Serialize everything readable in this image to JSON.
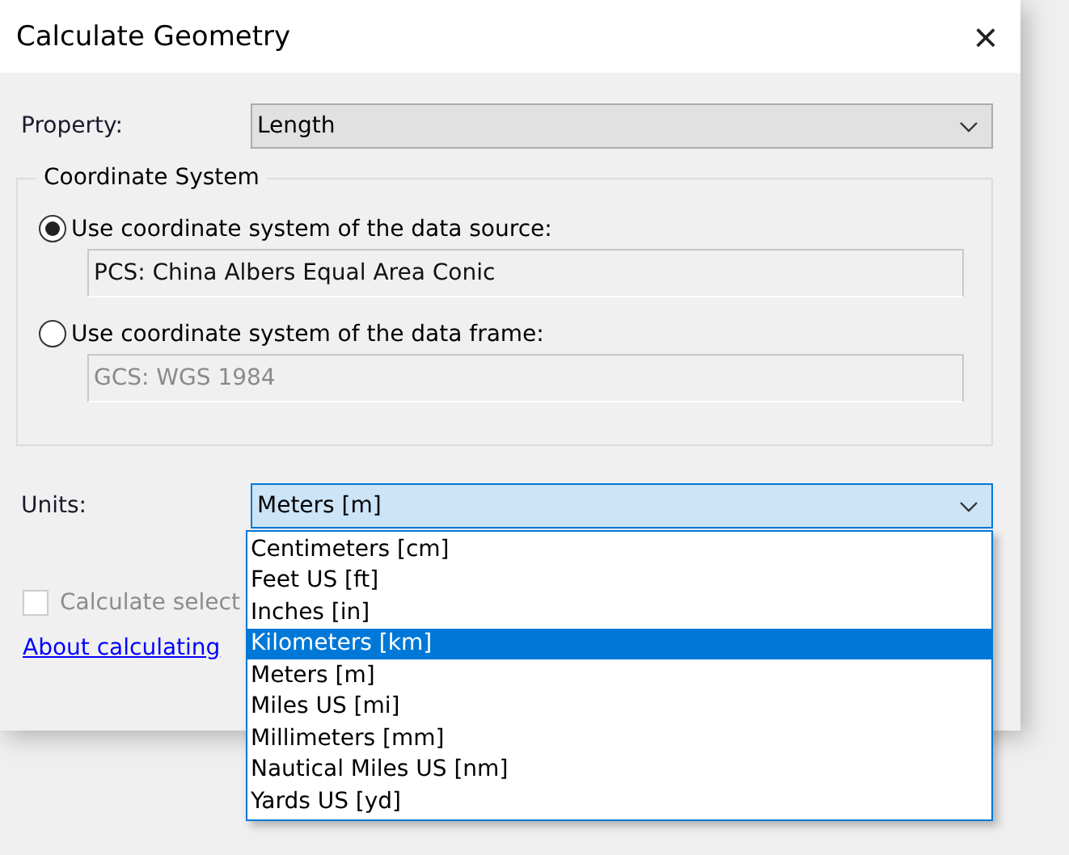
{
  "window": {
    "title": "Calculate Geometry",
    "close": "×"
  },
  "property": {
    "label": "Property:",
    "value": "Length"
  },
  "coordinate_system": {
    "title": "Coordinate System",
    "options": [
      {
        "label": "Use coordinate system of the data source:",
        "selected": true,
        "value": "PCS: China Albers Equal Area Conic",
        "disabled": false
      },
      {
        "label": "Use coordinate system of the data frame:",
        "selected": false,
        "value": "GCS: WGS 1984",
        "disabled": true
      }
    ]
  },
  "units": {
    "label": "Units:",
    "value": "Meters [m]",
    "expanded": true,
    "options": [
      {
        "label": "Centimeters [cm]",
        "highlighted": false
      },
      {
        "label": "Feet US [ft]",
        "highlighted": false
      },
      {
        "label": "Inches [in]",
        "highlighted": false
      },
      {
        "label": "Kilometers [km]",
        "highlighted": true
      },
      {
        "label": "Meters [m]",
        "highlighted": false
      },
      {
        "label": "Miles US [mi]",
        "highlighted": false
      },
      {
        "label": "Millimeters [mm]",
        "highlighted": false
      },
      {
        "label": "Nautical Miles US [nm]",
        "highlighted": false
      },
      {
        "label": "Yards US [yd]",
        "highlighted": false
      }
    ]
  },
  "selected_only": {
    "label": "Calculate select",
    "checked": false,
    "disabled": true
  },
  "help_link": "About calculating"
}
